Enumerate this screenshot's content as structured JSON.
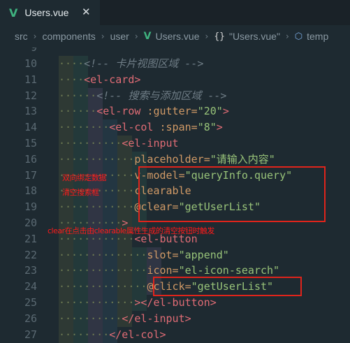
{
  "tab": {
    "icon": "vue-icon",
    "title": "Users.vue",
    "close_glyph": "✕"
  },
  "breadcrumb": {
    "items": [
      "src",
      "components",
      "user",
      "Users.vue",
      "\"Users.vue\"",
      "temp"
    ],
    "separator": "›"
  },
  "editor": {
    "line_numbers": [
      "9",
      "10",
      "11",
      "12",
      "13",
      "14",
      "15",
      "16",
      "17",
      "18",
      "19",
      "20",
      "21",
      "22",
      "23",
      "24",
      "25",
      "26",
      "27"
    ],
    "lines": {
      "l10_comment": "<!-- 卡片视图区域 -->",
      "l11_tag": "<el-card>",
      "l12_comment": "<!-- 搜索与添加区域 -->",
      "l13_open": "<el-row ",
      "l13_attr": ":gutter=",
      "l13_val": "\"20\"",
      "l13_close": ">",
      "l14_open": "<el-col ",
      "l14_attr": ":span=",
      "l14_val": "\"8\"",
      "l14_close": ">",
      "l15_tag": "<el-input",
      "l16_attr": "placeholder=",
      "l16_val": "\"请输入内容\"",
      "l17_attr": "v-model=",
      "l17_val": "\"queryInfo.query\"",
      "l18_attr": "clearable",
      "l19_attr": "@clear=",
      "l19_val": "\"getUserList\"",
      "l20_tag": ">",
      "l21_tag": "<el-button",
      "l22_attr": "slot=",
      "l22_val": "\"append\"",
      "l23_attr": "icon=",
      "l23_val": "\"el-icon-search\"",
      "l24_attr": "@click=",
      "l24_val": "\"getUserList\"",
      "l25_tag": "></el-button>",
      "l26_tag": "</el-input>",
      "l27_tag": "</el-col>"
    }
  },
  "annotations": {
    "note1": "双向绑定数据",
    "note2": "清空搜索框",
    "note3": "clear在点击由clearable属性生成的清空按钮时触发"
  },
  "colors": {
    "background": "#1e2a31",
    "tag": "#e06c75",
    "attribute": "#d19a66",
    "string": "#98c379",
    "comment": "#6f7d86",
    "annotation_red": "#ff1a1a",
    "vue_green": "#3fb27f"
  }
}
